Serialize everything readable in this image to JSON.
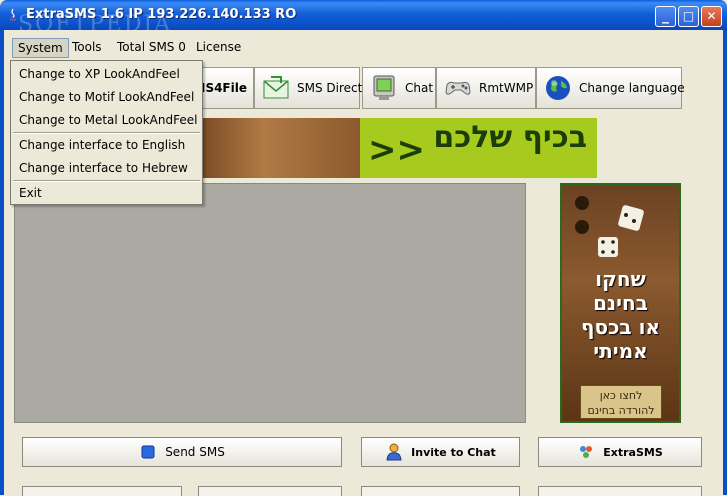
{
  "window": {
    "title": "ExtraSMS 1.6 IP 193.226.140.133 RO",
    "watermark": "SOFTPEDIA",
    "controls": {
      "minimize": "_",
      "maximize": "□",
      "close": "✕"
    }
  },
  "menubar": [
    "System",
    "Tools",
    "Total SMS 0",
    "License"
  ],
  "toolbar": {
    "items": [
      {
        "label": "SMS4File",
        "icon": "sms4file-icon"
      },
      {
        "label": "SMS Direct",
        "icon": "envelope-icon"
      },
      {
        "label": "Chat",
        "icon": "chat-icon"
      },
      {
        "label": "RmtWMP",
        "icon": "gamepad-icon"
      },
      {
        "label": "Change language",
        "icon": "globe-icon"
      }
    ]
  },
  "banner": {
    "text": "בכיף שלכם",
    "arrows": ">>"
  },
  "side_ad": {
    "lines": [
      "שחקו",
      "בחינם",
      "או בכסף",
      "אמיתי"
    ],
    "cta": "לחצו כאן להורדה בחינם"
  },
  "bottom_buttons": {
    "send_sms": "Send SMS",
    "invite_chat": "Invite to Chat",
    "extrasms": "ExtraSMS"
  },
  "system_menu": {
    "items": [
      "Change to XP LookAndFeel",
      "Change to Motif LookAndFeel",
      "Change to Metal LookAndFeel",
      "Change interface to English",
      "Change interface to Hebrew",
      "Exit"
    ]
  },
  "colors": {
    "titlebar": "#0b4fc6",
    "banner_green": "#a6ca1d",
    "panel": "#aaaaa2"
  }
}
